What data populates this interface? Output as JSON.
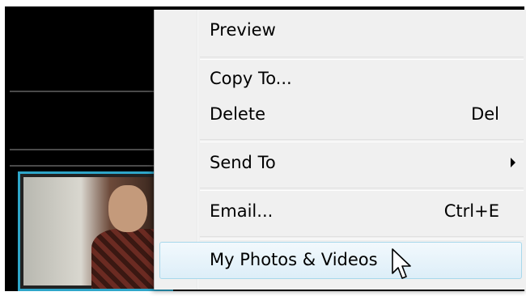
{
  "context_menu": {
    "items": [
      {
        "label": "Preview",
        "shortcut": ""
      },
      {
        "label": "Copy To...",
        "shortcut": ""
      },
      {
        "label": "Delete",
        "shortcut": "Del"
      },
      {
        "label": "Send To",
        "shortcut": "",
        "submenu": true
      },
      {
        "label": "Email...",
        "shortcut": "Ctrl+E"
      },
      {
        "label": "My Photos & Videos",
        "shortcut": "",
        "highlighted": true
      }
    ]
  },
  "colors": {
    "background": "#000000",
    "menu_background": "#f0f0f0",
    "thumbnail_border": "#2ea6c9",
    "highlight_border": "#a8d8eb"
  },
  "icons": {
    "submenu_arrow": "chevron-right-icon",
    "cursor": "mouse-cursor-icon"
  }
}
